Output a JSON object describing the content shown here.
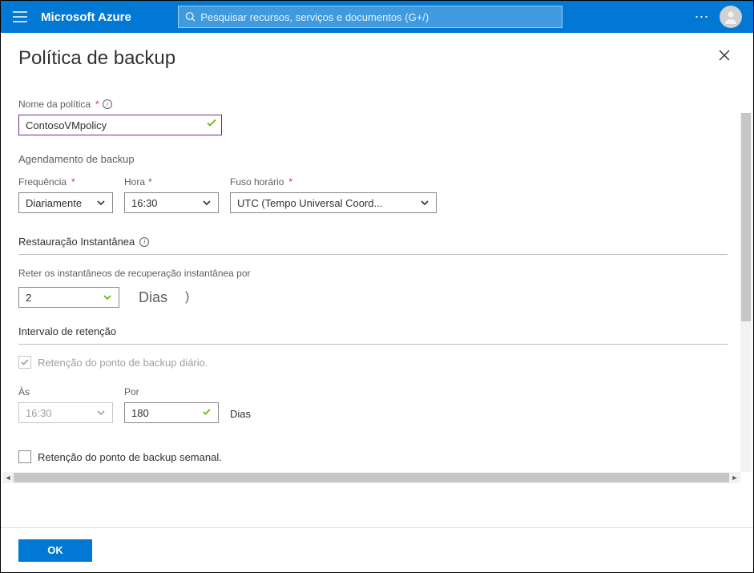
{
  "header": {
    "brand": "Microsoft Azure",
    "search_placeholder": "Pesquisar recursos, serviços e documentos (G+/)"
  },
  "blade": {
    "title": "Política de backup",
    "policy_name_label": "Nome da política",
    "policy_name_value": "ContosoVMpolicy",
    "schedule_heading": "Agendamento de backup",
    "frequency_label": "Frequência",
    "frequency_value": "Diariamente",
    "time_label": "Hora",
    "time_value": "16:30",
    "timezone_label": "Fuso horário",
    "timezone_value": "UTC (Tempo Universal Coord...",
    "instant_restore_heading": "Restauração Instantânea",
    "instant_restore_label": "Reter os instantâneos de recuperação instantânea por",
    "instant_restore_value": "2",
    "days_word": "Dias",
    "retention_heading": "Intervalo de retenção",
    "daily_retention_label": "Retenção do ponto de backup diário.",
    "at_label": "Às",
    "at_value": "16:30",
    "for_label": "Por",
    "for_value": "180",
    "for_unit": "Dias",
    "weekly_retention_label": "Retenção do ponto de backup semanal."
  },
  "footer": {
    "ok_label": "OK"
  },
  "icons": {
    "info": "i",
    "paren": ")"
  }
}
